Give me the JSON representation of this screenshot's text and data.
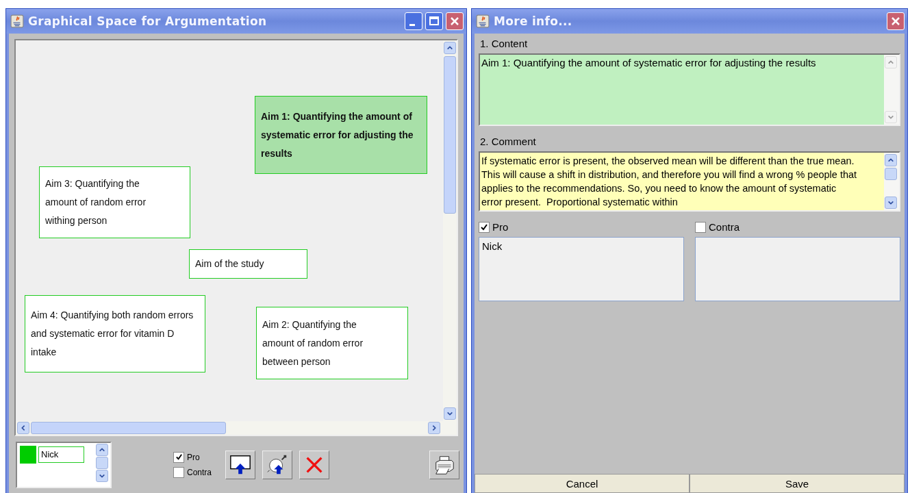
{
  "main_window": {
    "title": "Graphical Space for Argumentation"
  },
  "canvas": {
    "nodes": [
      {
        "text": "Aim 1: Quantifying the amount of systematic error for adjusting the results",
        "selected": true
      },
      {
        "text": "Aim 3: Quantifying the amount of random error withing person",
        "selected": false
      },
      {
        "text": "Aim of the study",
        "selected": false
      },
      {
        "text": "Aim 4: Quantifying both random errors and systematic error for vitamin D intake",
        "selected": false
      },
      {
        "text": "Aim 2: Quantifying the amount of random error between person",
        "selected": false
      }
    ]
  },
  "toolbar": {
    "users": [
      {
        "name": "Nick",
        "color": "#00cc00"
      }
    ],
    "filters": [
      {
        "label": "Pro",
        "checked": true
      },
      {
        "label": "Contra",
        "checked": false
      }
    ]
  },
  "info_window": {
    "title": "More info...",
    "content_label": "1. Content",
    "content": "Aim 1: Quantifying the amount of systematic error for adjusting the results",
    "comment_label": "2. Comment",
    "comment": "If systematic error is present, the observed mean will be different than the true mean. This will cause a shift in distribution, and therefore you will find a wrong % people that applies to the recommendations. So, you need to know the amount of systematic error present.  Proportional systematic within",
    "votes": [
      {
        "label": "Pro",
        "checked": true,
        "names": [
          "Nick"
        ]
      },
      {
        "label": "Contra",
        "checked": false
      }
    ],
    "buttons": [
      "Cancel",
      "Save"
    ]
  }
}
